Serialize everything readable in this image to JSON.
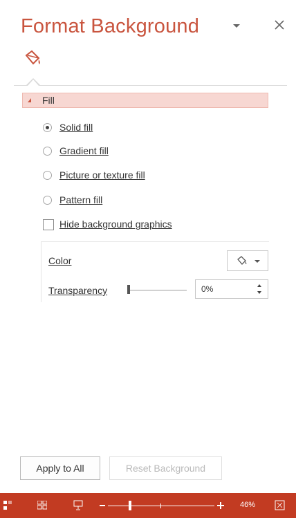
{
  "pane": {
    "title": "Format Background",
    "menu_icon": "dropdown-caret-icon",
    "close_icon": "close-icon",
    "tab_icon": "paint-bucket-icon"
  },
  "fill_section": {
    "header": "Fill",
    "options": [
      {
        "label": "Solid fill",
        "selected": true
      },
      {
        "label": "Gradient fill",
        "selected": false
      },
      {
        "label": "Picture or texture fill",
        "selected": false
      },
      {
        "label": "Pattern fill",
        "selected": false
      }
    ],
    "hide_background": {
      "label": "Hide background graphics",
      "checked": false
    },
    "color": {
      "label": "Color",
      "icon": "paint-bucket-icon"
    },
    "transparency": {
      "label": "Transparency",
      "value": "0%"
    }
  },
  "buttons": {
    "apply": "Apply to All",
    "reset": "Reset Background"
  },
  "statusbar": {
    "zoom": "46%",
    "accent": "#c23b22"
  },
  "colors": {
    "title": "#c9553f",
    "section_bg": "#f7d7d2"
  }
}
